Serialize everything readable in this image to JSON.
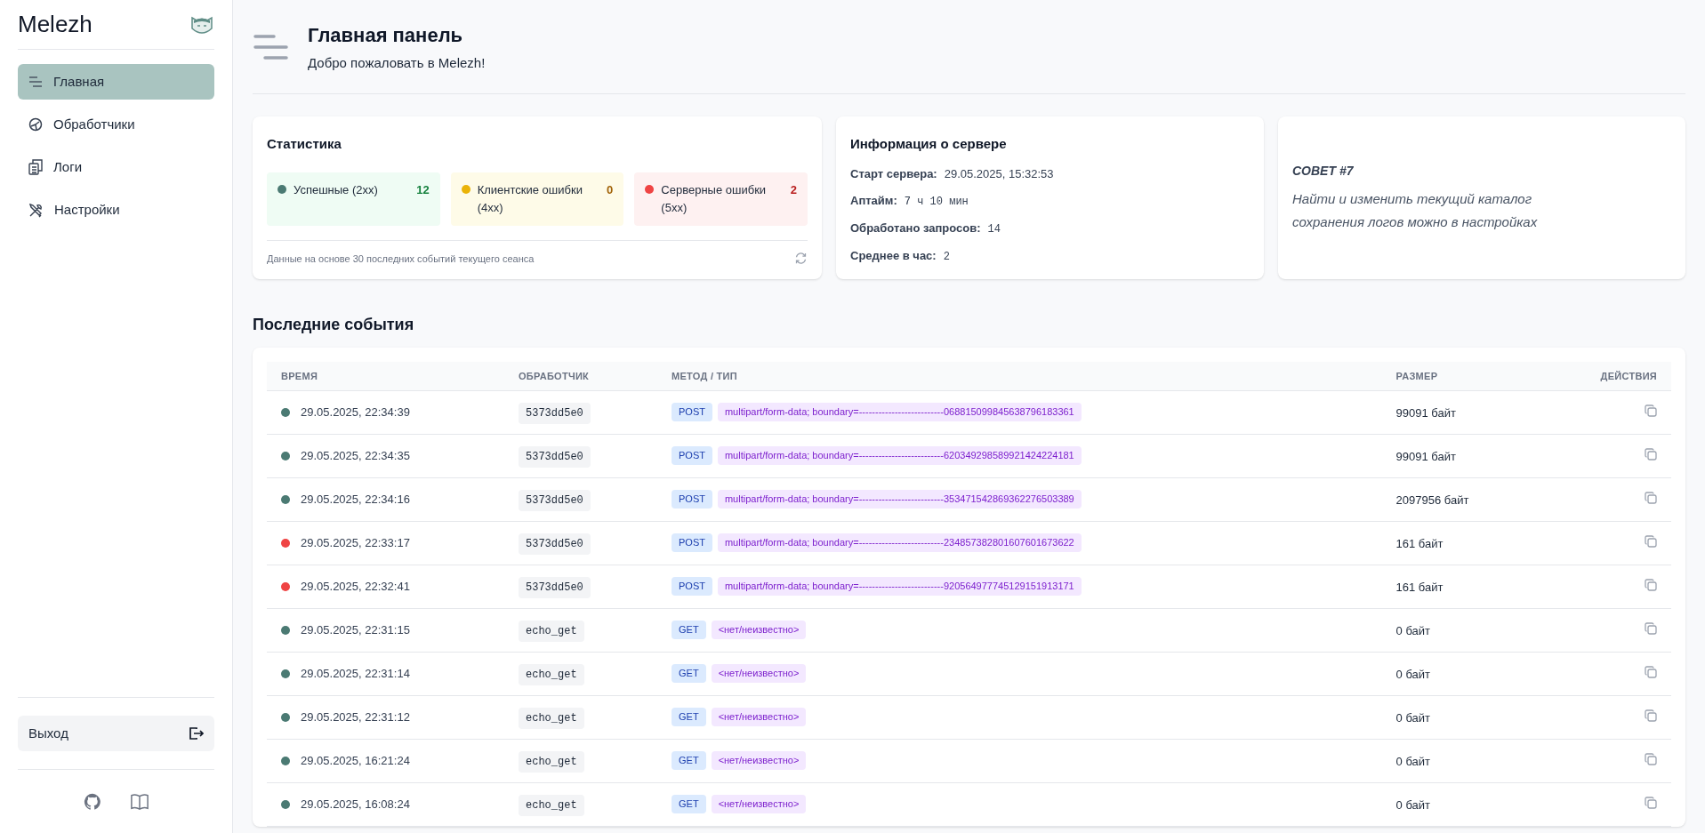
{
  "sidebar": {
    "brand": "Melezh",
    "items": [
      {
        "label": "Главная",
        "kind": "lines",
        "selected": true
      },
      {
        "label": "Обработчики",
        "kind": "gauge",
        "selected": false
      },
      {
        "label": "Логи",
        "kind": "files",
        "selected": false
      },
      {
        "label": "Настройки",
        "kind": "tools",
        "selected": false
      }
    ],
    "logout": "Выход"
  },
  "header": {
    "title": "Главная панель",
    "subtitle": "Добро пожаловать в Melezh!"
  },
  "stats": {
    "title": "Статистика",
    "items": [
      {
        "kind": "success",
        "label": "Успешные (2xx)",
        "count": "12",
        "color": "#4b7a73"
      },
      {
        "kind": "client",
        "label": "Клиентские ошибки (4xx)",
        "count": "0",
        "color": "#eab308"
      },
      {
        "kind": "server",
        "label": "Серверные ошибки (5xx)",
        "count": "2",
        "color": "#ef4444"
      }
    ],
    "note": "Данные на основе 30 последних событий текущего сеанса"
  },
  "server_info": {
    "title": "Информация о сервере",
    "fields": [
      {
        "label": "Старт сервера:",
        "value": "29.05.2025, 15:32:53",
        "kind": "plain"
      },
      {
        "label": "Аптайм:",
        "value": "7 ч 10 мин",
        "kind": "mono"
      },
      {
        "label": "Обработано запросов:",
        "value": "14",
        "kind": "mono"
      },
      {
        "label": "Среднее в час:",
        "value": "2",
        "kind": "mono"
      }
    ]
  },
  "tip": {
    "title": "СОВЕТ #7",
    "text": "Найти и изменить текущий каталог сохранения логов можно в настройках"
  },
  "events": {
    "title": "Последние события",
    "columns": [
      "ВРЕМЯ",
      "ОБРАБОТЧИК",
      "МЕТОД / ТИП",
      "РАЗМЕР",
      "ДЕЙСТВИЯ"
    ],
    "rows": [
      {
        "color": "#4b7a73",
        "time": "29.05.2025, 22:34:39",
        "handler": "5373dd5e0",
        "method": "POST",
        "type": "multipart/form-data; boundary=--------------------------068815099845638796183361",
        "size": "99091 байт"
      },
      {
        "color": "#4b7a73",
        "time": "29.05.2025, 22:34:35",
        "handler": "5373dd5e0",
        "method": "POST",
        "type": "multipart/form-data; boundary=--------------------------620349298589921424224181",
        "size": "99091 байт"
      },
      {
        "color": "#4b7a73",
        "time": "29.05.2025, 22:34:16",
        "handler": "5373dd5e0",
        "method": "POST",
        "type": "multipart/form-data; boundary=--------------------------353471542869362276503389",
        "size": "2097956 байт"
      },
      {
        "color": "#ef4444",
        "time": "29.05.2025, 22:33:17",
        "handler": "5373dd5e0",
        "method": "POST",
        "type": "multipart/form-data; boundary=--------------------------234857382801607601673622",
        "size": "161 байт"
      },
      {
        "color": "#ef4444",
        "time": "29.05.2025, 22:32:41",
        "handler": "5373dd5e0",
        "method": "POST",
        "type": "multipart/form-data; boundary=--------------------------920564977745129151913171",
        "size": "161 байт"
      },
      {
        "color": "#4b7a73",
        "time": "29.05.2025, 22:31:15",
        "handler": "echo_get",
        "method": "GET",
        "type": "<нет/неизвестно>",
        "size": "0 байт"
      },
      {
        "color": "#4b7a73",
        "time": "29.05.2025, 22:31:14",
        "handler": "echo_get",
        "method": "GET",
        "type": "<нет/неизвестно>",
        "size": "0 байт"
      },
      {
        "color": "#4b7a73",
        "time": "29.05.2025, 22:31:12",
        "handler": "echo_get",
        "method": "GET",
        "type": "<нет/неизвестно>",
        "size": "0 байт"
      },
      {
        "color": "#4b7a73",
        "time": "29.05.2025, 16:21:24",
        "handler": "echo_get",
        "method": "GET",
        "type": "<нет/неизвестно>",
        "size": "0 байт"
      },
      {
        "color": "#4b7a73",
        "time": "29.05.2025, 16:08:24",
        "handler": "echo_get",
        "method": "GET",
        "type": "<нет/неизвестно>",
        "size": "0 байт"
      }
    ]
  }
}
